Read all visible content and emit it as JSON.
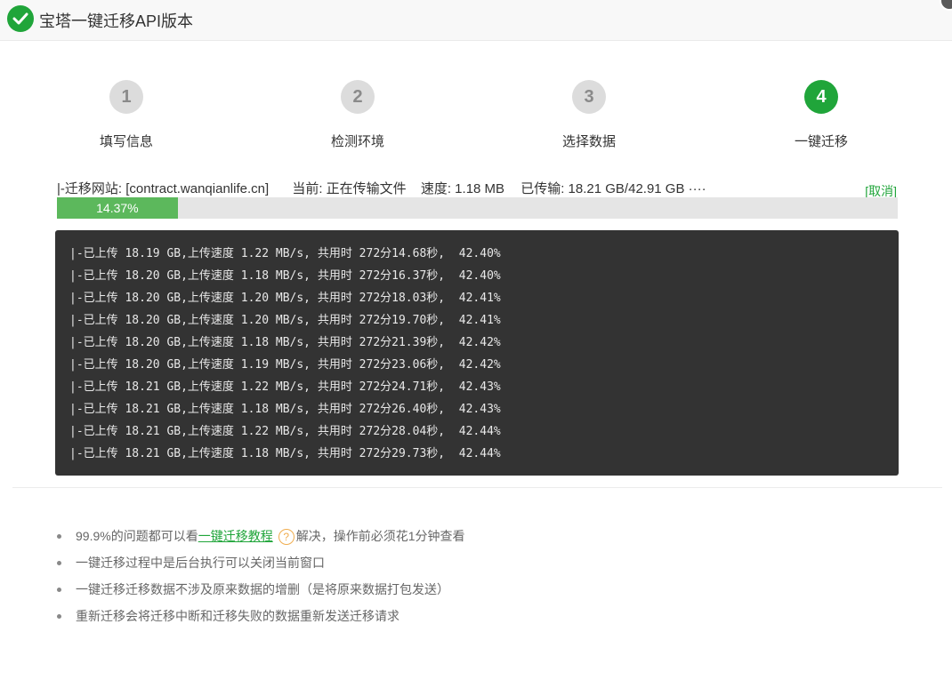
{
  "window": {
    "title": "宝塔一键迁移API版本"
  },
  "steps": [
    {
      "number": "1",
      "label": "填写信息",
      "active": false
    },
    {
      "number": "2",
      "label": "检测环境",
      "active": false
    },
    {
      "number": "3",
      "label": "选择数据",
      "active": false
    },
    {
      "number": "4",
      "label": "一键迁移",
      "active": true
    }
  ],
  "status": {
    "site": "|-迁移网站: [contract.wanqianlife.cn]",
    "current": "当前: 正在传输文件",
    "speed": "速度: 1.18 MB",
    "transferred": "已传输: 18.21 GB/42.91 GB ····",
    "cancel_label": "[取消]"
  },
  "progress": {
    "percent": 14.37,
    "label": "14.37%"
  },
  "log_lines": [
    "|-已上传 18.19 GB,上传速度 1.22 MB/s, 共用时 272分14.68秒,  42.40%",
    "|-已上传 18.20 GB,上传速度 1.18 MB/s, 共用时 272分16.37秒,  42.40%",
    "|-已上传 18.20 GB,上传速度 1.20 MB/s, 共用时 272分18.03秒,  42.41%",
    "|-已上传 18.20 GB,上传速度 1.20 MB/s, 共用时 272分19.70秒,  42.41%",
    "|-已上传 18.20 GB,上传速度 1.18 MB/s, 共用时 272分21.39秒,  42.42%",
    "|-已上传 18.20 GB,上传速度 1.19 MB/s, 共用时 272分23.06秒,  42.42%",
    "|-已上传 18.21 GB,上传速度 1.22 MB/s, 共用时 272分24.71秒,  42.43%",
    "|-已上传 18.21 GB,上传速度 1.18 MB/s, 共用时 272分26.40秒,  42.43%",
    "|-已上传 18.21 GB,上传速度 1.22 MB/s, 共用时 272分28.04秒,  42.44%",
    "|-已上传 18.21 GB,上传速度 1.18 MB/s, 共用时 272分29.73秒,  42.44%"
  ],
  "tips": {
    "tip1_before": "99.9%的问题都可以看",
    "tip1_link": "一键迁移教程",
    "tip1_help": "?",
    "tip1_after": "解决，操作前必须花1分钟查看",
    "tip2": "一键迁移过程中是后台执行可以关闭当前窗口",
    "tip3": "一键迁移迁移数据不涉及原来数据的增删（是将原来数据打包发送）",
    "tip4": "重新迁移会将迁移中断和迁移失败的数据重新发送迁移请求"
  },
  "colors": {
    "accent": "#20a53a",
    "progress_fill": "#5cb85c",
    "console_bg": "#333333",
    "help_icon": "#f0ad4e"
  }
}
